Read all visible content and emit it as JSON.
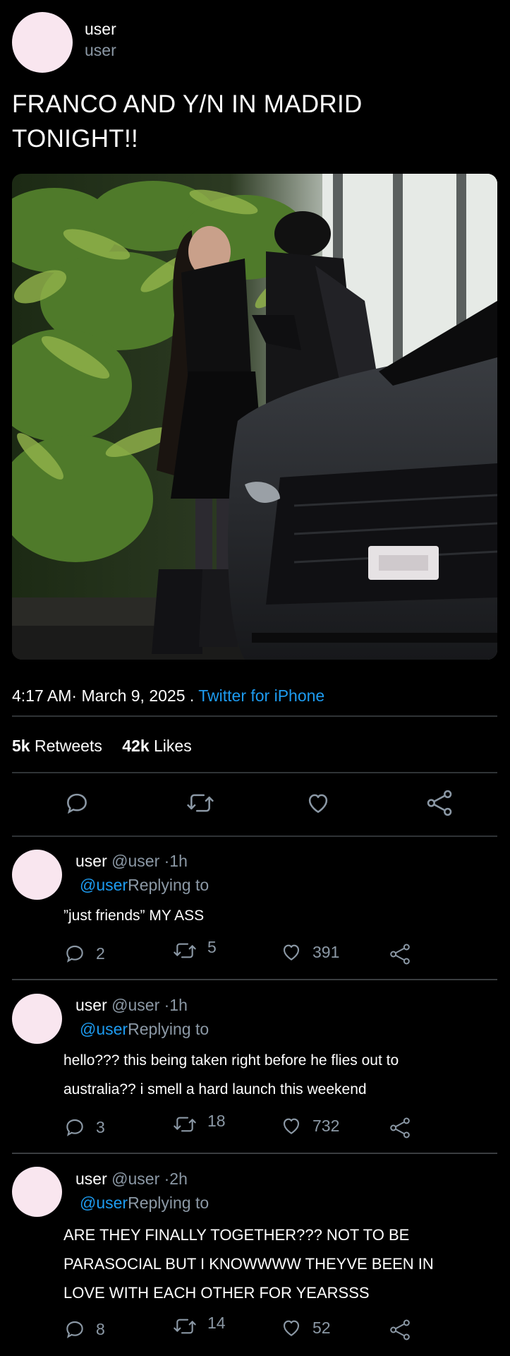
{
  "tweet": {
    "display_name": "user",
    "handle": "user",
    "text_line1": "FRANCO AND Y/N IN MADRID",
    "text_line2": "TONIGHT!!",
    "time": "4:17 AM",
    "date_sep": "·",
    "date": "March 9, 2025 .",
    "source": "Twitter for iPhone",
    "retweets_count": "5k",
    "retweets_label": "Retweets",
    "likes_count": "42k",
    "likes_label": "Likes"
  },
  "actions": {
    "icons": [
      "reply-icon",
      "retweet-icon",
      "like-icon",
      "share-icon"
    ]
  },
  "replies": [
    {
      "name": "user",
      "handle": "@user",
      "time": "·1h",
      "mention": "@user",
      "replying": "Replying to",
      "lines": [
        "”just friends” MY ASS"
      ],
      "replies": "2",
      "retweets": "5",
      "likes": "391"
    },
    {
      "name": "user",
      "handle": "@user",
      "time": "·1h",
      "mention": "@user",
      "replying": "Replying to",
      "lines": [
        "hello??? this being taken right before he flies out to",
        "australia?? i smell a hard launch this weekend"
      ],
      "replies": "3",
      "retweets": "18",
      "likes": "732"
    },
    {
      "name": "user",
      "handle": "@user",
      "time": "·2h",
      "mention": "@user",
      "replying": "Replying to",
      "lines": [
        "ARE THEY FINALLY TOGETHER??? NOT TO BE",
        "PARASOCIAL BUT I KNOWWWW THEYVE BEEN IN",
        "LOVE WITH EACH OTHER FOR YEARSSS"
      ],
      "replies": "8",
      "retweets": "14",
      "likes": "52"
    }
  ],
  "colors": {
    "background": "#000000",
    "link": "#1d9bf0",
    "muted": "#8b98a5",
    "avatar": "#f9e6ef",
    "divider": "#2f3336"
  }
}
